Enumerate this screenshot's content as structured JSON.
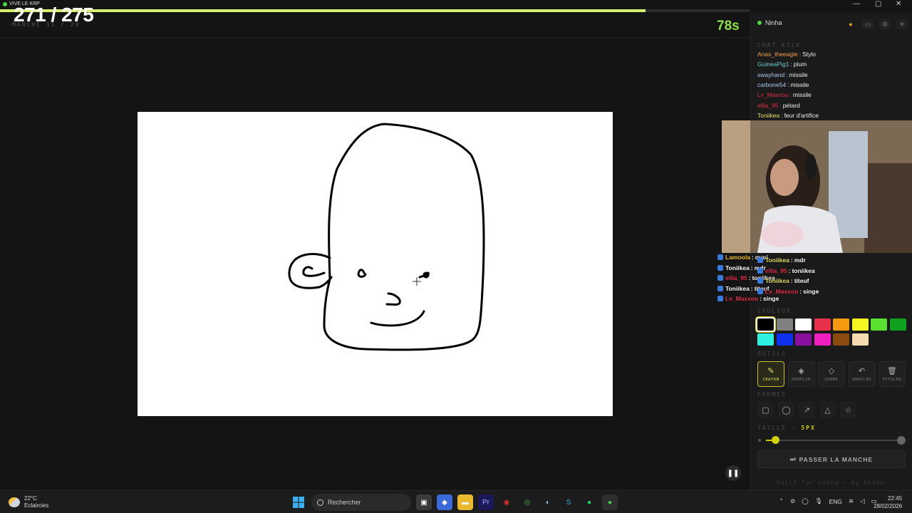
{
  "window": {
    "title": "VIVE LE KRP"
  },
  "header": {
    "counter": "271 / 275",
    "round": "MANCHE 11 / 20",
    "timer": "78s",
    "progress_fraction": 0.86
  },
  "panel": {
    "username": "Ninha",
    "chat_label": "CHAT KICK",
    "chat": [
      {
        "user": "Anas_theeagle",
        "color": "#f0a050",
        "text": "Stylo"
      },
      {
        "user": "GuineaPig1",
        "color": "#6ad0d0",
        "text": "plum"
      },
      {
        "user": "swayhand",
        "color": "#a8c8f0",
        "text": "missile"
      },
      {
        "user": "carbone54",
        "color": "#a8c8f0",
        "text": "missile"
      },
      {
        "user": "Lv_Maxxou",
        "color": "#e0304a",
        "text": "missile"
      },
      {
        "user": "ellia_95",
        "color": "#e0304a",
        "text": "pétard"
      },
      {
        "user": "Toniikea",
        "color": "#e0e060",
        "text": "feur d'artifice"
      }
    ],
    "overlay_left": [
      {
        "user": "Lamoola",
        "color": "#f0c030",
        "text": "quoi"
      },
      {
        "user": "Toniikea",
        "color": "#ffffff",
        "text": "mdr"
      },
      {
        "user": "ellia_95",
        "color": "#e0304a",
        "text": "toniikea"
      },
      {
        "user": "Toniikea",
        "color": "#ffffff",
        "text": "titeuf"
      },
      {
        "user": "Lv_Maxxou",
        "color": "#e0304a",
        "text": "singe"
      }
    ],
    "overlay_right": [
      {
        "user": "Toniikea",
        "color": "#e0e060",
        "text": "mdr"
      },
      {
        "user": "ellia_95",
        "color": "#e0304a",
        "text": "toniikea"
      },
      {
        "user": "Toniikea",
        "color": "#e0e060",
        "text": "titeuf"
      },
      {
        "user": "Lv_Maxxou",
        "color": "#e0304a",
        "text": "singe"
      }
    ],
    "color_label": "COULEUR",
    "colors": [
      "#000000",
      "#808080",
      "#ffffff",
      "#e8304a",
      "#f59a10",
      "#f5f520",
      "#5ae030",
      "#10a020",
      "#30f0e0",
      "#1030f0",
      "#8a10a0",
      "#f020c0",
      "#8a4a10",
      "#f5dcb0",
      "#1a1a1a"
    ],
    "selected_color": "#000000",
    "tools_label": "OUTILS",
    "tools": [
      {
        "icon": "pencil-icon",
        "glyph": "✎",
        "label": "CRAYON",
        "active": true
      },
      {
        "icon": "fill-icon",
        "glyph": "◈",
        "label": "REMPLIR",
        "active": false
      },
      {
        "icon": "eraser-icon",
        "glyph": "◇",
        "label": "GOMME",
        "active": false
      },
      {
        "icon": "undo-icon",
        "glyph": "↶",
        "label": "ANNULER",
        "active": false
      },
      {
        "icon": "trash-icon",
        "glyph": "🗑",
        "label": "EFFACER",
        "active": false
      }
    ],
    "shapes_label": "FORMES",
    "shapes": [
      {
        "icon": "rectangle-icon",
        "glyph": "▢"
      },
      {
        "icon": "ellipse-icon",
        "glyph": "◯"
      },
      {
        "icon": "arrow-icon",
        "glyph": "↗"
      },
      {
        "icon": "triangle-icon",
        "glyph": "△"
      },
      {
        "icon": "star-icon",
        "glyph": "☆"
      }
    ],
    "size_label": "TAILLE —",
    "size_value": "5PX",
    "size_fraction": 0.07,
    "skip_label": "PASSER LA MANCHE",
    "footer": "built for ninha — by keido"
  },
  "taskbar": {
    "temp": "22°C",
    "weather": "Eclaircies",
    "search_placeholder": "Rechercher",
    "lang": "ENG",
    "time": "22:45",
    "date": "28/02/2026"
  }
}
